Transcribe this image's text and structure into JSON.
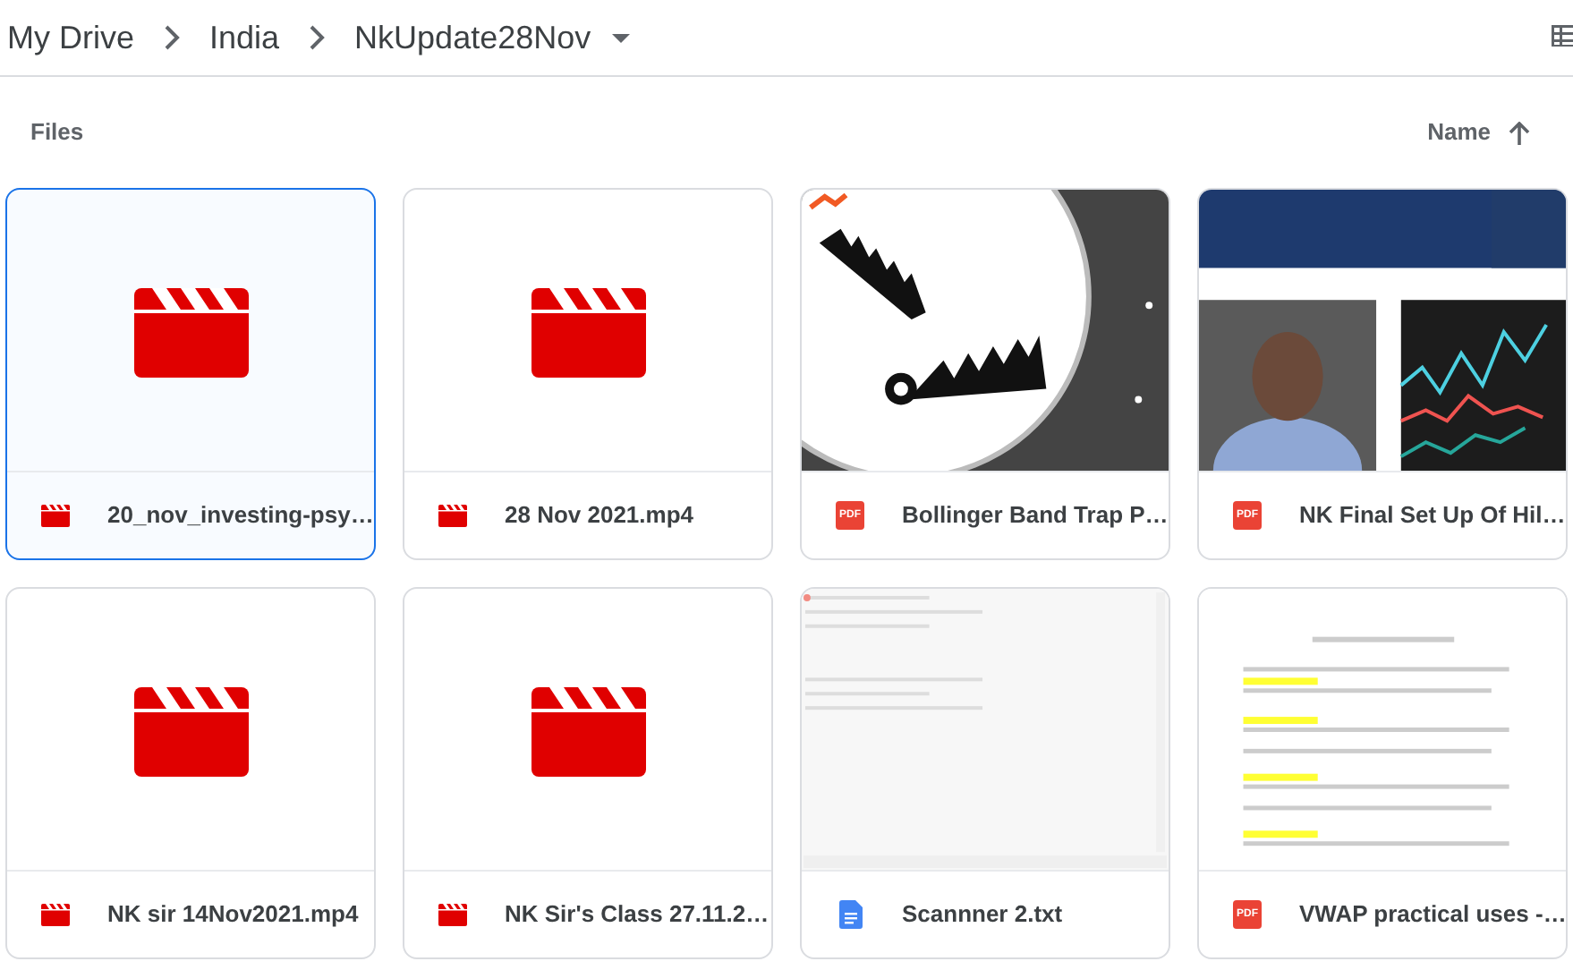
{
  "breadcrumb": [
    {
      "label": "My Drive"
    },
    {
      "label": "India"
    },
    {
      "label": "NkUpdate28Nov"
    }
  ],
  "section": {
    "title": "Files",
    "sort": "Name"
  },
  "files": [
    {
      "name": "20_nov_investing-psy…",
      "kind": "video",
      "selected": true,
      "thumbnail": {
        "kind": "icon"
      }
    },
    {
      "name": "28 Nov 2021.mp4",
      "kind": "video",
      "selected": false,
      "thumbnail": {
        "kind": "icon"
      }
    },
    {
      "name": "Bollinger Band Trap P…",
      "kind": "pdf",
      "icon_label": "PDF",
      "selected": false
    },
    {
      "name": "NK Final Set Up Of Hil…",
      "kind": "pdf",
      "icon_label": "PDF",
      "selected": false
    },
    {
      "name": "NK sir 14Nov2021.mp4",
      "kind": "video",
      "selected": false,
      "thumbnail": {
        "kind": "icon"
      }
    },
    {
      "name": "NK Sir's Class 27.11.2…",
      "kind": "video",
      "selected": false,
      "thumbnail": {
        "kind": "icon"
      }
    },
    {
      "name": "Scannner 2.txt",
      "kind": "doc",
      "selected": false
    },
    {
      "name": "VWAP practical uses -…",
      "kind": "pdf",
      "icon_label": "PDF",
      "selected": false
    }
  ]
}
